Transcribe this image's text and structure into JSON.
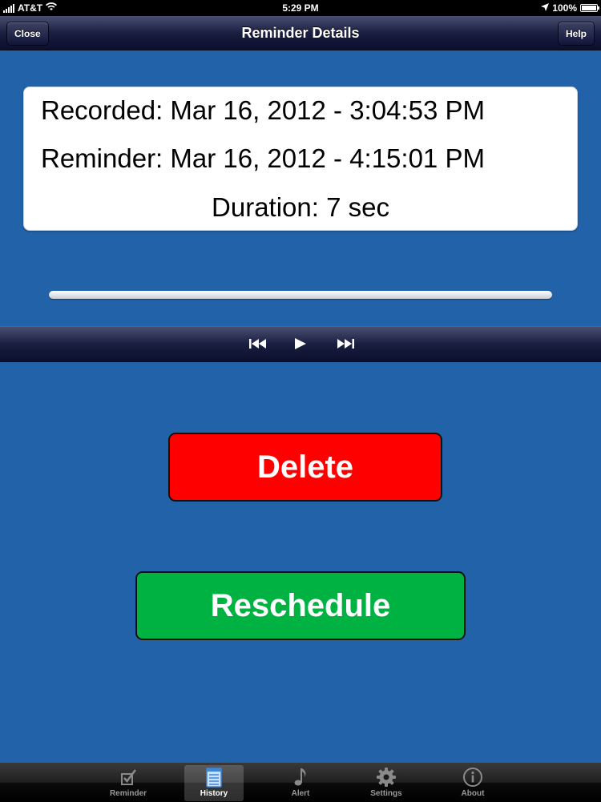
{
  "status_bar": {
    "carrier": "AT&T",
    "time": "5:29 PM",
    "battery": "100%",
    "battery_level": 1.0
  },
  "nav": {
    "title": "Reminder Details",
    "close_label": "Close",
    "help_label": "Help"
  },
  "details": {
    "recorded": "Recorded: Mar 16, 2012 - 3:04:53 PM",
    "reminder": "Reminder: Mar 16, 2012 - 4:15:01 PM",
    "duration": "Duration: 7 sec"
  },
  "playback": {
    "progress": 0.0
  },
  "actions": {
    "delete_label": "Delete",
    "reschedule_label": "Reschedule"
  },
  "tabs": [
    {
      "label": "Reminder",
      "icon": "checkbox-icon",
      "active": false
    },
    {
      "label": "History",
      "icon": "notepad-icon",
      "active": true
    },
    {
      "label": "Alert",
      "icon": "music-note-icon",
      "active": false
    },
    {
      "label": "Settings",
      "icon": "gear-icon",
      "active": false
    },
    {
      "label": "About",
      "icon": "info-icon",
      "active": false
    }
  ],
  "colors": {
    "background": "#2162a8",
    "delete": "#fe0000",
    "reschedule": "#00b242"
  }
}
